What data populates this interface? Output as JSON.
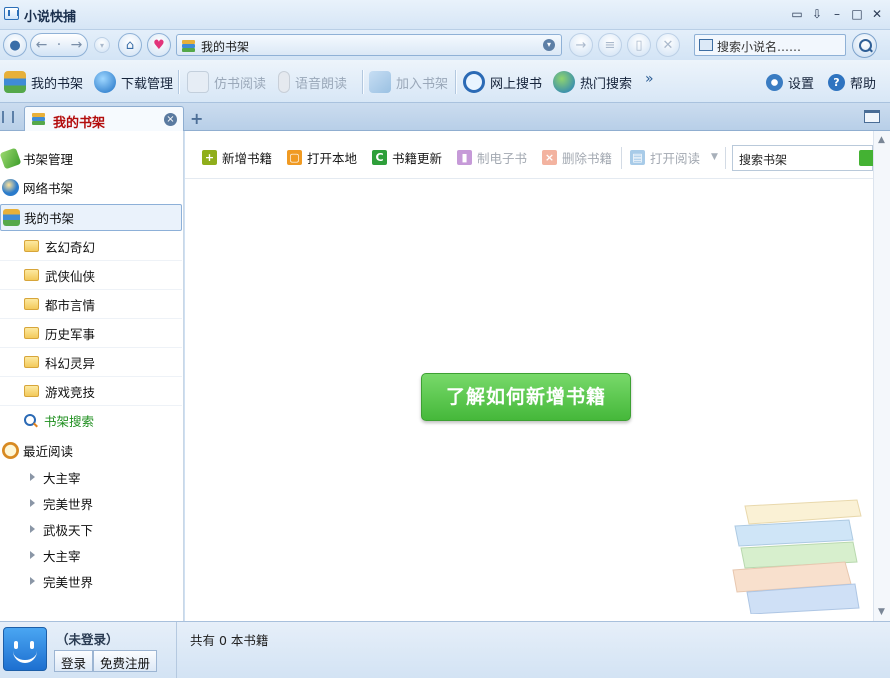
{
  "window": {
    "title": "小说快捕"
  },
  "address": {
    "text": "我的书架",
    "search_placeholder": "搜索小说名……"
  },
  "toolbar": [
    {
      "label": "我的书架",
      "icon": "books-icon",
      "enabled": true
    },
    {
      "label": "下载管理",
      "icon": "globe-download-icon",
      "enabled": true
    },
    {
      "label": "仿书阅读",
      "icon": "open-book-icon",
      "enabled": false
    },
    {
      "label": "语音朗读",
      "icon": "microphone-icon",
      "enabled": false
    },
    {
      "label": "加入书架",
      "icon": "add-book-icon",
      "enabled": false
    },
    {
      "label": "网上搜书",
      "icon": "web-search-icon",
      "enabled": true
    },
    {
      "label": "热门搜索",
      "icon": "hot-search-globe-icon",
      "enabled": true
    }
  ],
  "toolbar_right": {
    "settings": "设置",
    "help": "帮助"
  },
  "tab": {
    "label": "我的书架"
  },
  "sidebar": {
    "shelf_manage": "书架管理",
    "web_shelf": "网络书架",
    "my_shelf": "我的书架",
    "folders": [
      "玄幻奇幻",
      "武侠仙侠",
      "都市言情",
      "历史军事",
      "科幻灵异",
      "游戏竞技"
    ],
    "shelf_search": "书架搜索",
    "recent_title": "最近阅读",
    "recent": [
      "大主宰",
      "完美世界",
      "武极天下",
      "大主宰",
      "完美世界"
    ]
  },
  "content_toolbar": [
    {
      "label": "新增书籍",
      "color": "#8fae1b",
      "glyph": "+",
      "enabled": true
    },
    {
      "label": "打开本地",
      "color": "#f09a22",
      "glyph": "▢",
      "enabled": true
    },
    {
      "label": "书籍更新",
      "color": "#2e9f3a",
      "glyph": "C",
      "enabled": true
    },
    {
      "label": "制电子书",
      "color": "#c69ad8",
      "glyph": "▮",
      "enabled": false
    },
    {
      "label": "删除书籍",
      "color": "#f3b3a0",
      "glyph": "×",
      "enabled": false
    },
    {
      "label": "打开阅读",
      "color": "#a8cbe8",
      "glyph": "▤",
      "enabled": false
    }
  ],
  "content_search_placeholder": "搜索书架",
  "cta_button": "了解如何新增书籍",
  "status": {
    "login_state": "（未登录）",
    "login": "登录",
    "register": "免费注册",
    "book_count_text": "共有 0 本书籍"
  },
  "colors": {
    "accent": "#2b6fb8",
    "cta_green": "#45b83a",
    "tab_label": "#b30d0d"
  }
}
